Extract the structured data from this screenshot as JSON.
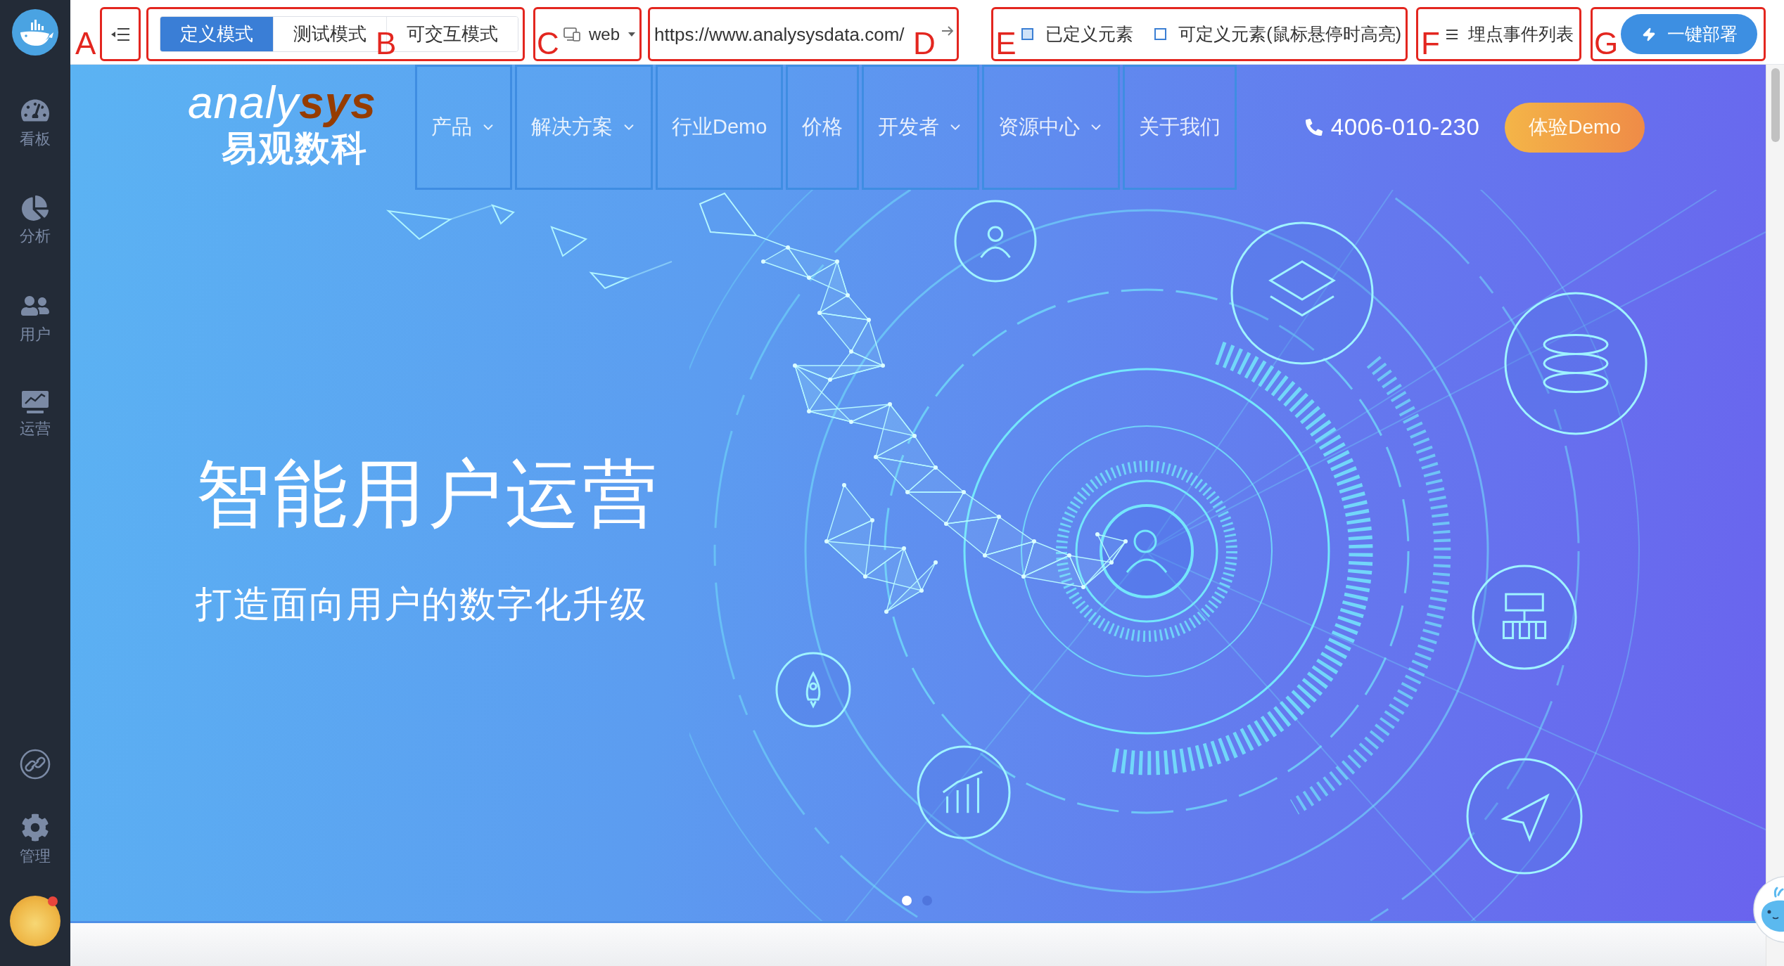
{
  "sidebar": {
    "items": [
      {
        "label": "看板",
        "kind": "gauge",
        "selected": false
      },
      {
        "label": "分析",
        "kind": "pie",
        "selected": false
      },
      {
        "label": "用户",
        "kind": "users",
        "selected": false
      },
      {
        "label": "运营",
        "kind": "monitor",
        "selected": false
      }
    ],
    "bottom_items": [
      {
        "kind": "link",
        "selected": false
      },
      {
        "label": "管理",
        "kind": "gear",
        "selected": false
      }
    ],
    "avatar": {
      "unread": true
    }
  },
  "toolbar": {
    "menu_toggle": {
      "annotation": "A"
    },
    "modes": {
      "annotation": "B",
      "items": [
        {
          "label": "定义模式",
          "selected": true
        },
        {
          "label": "测试模式",
          "selected": false
        },
        {
          "label": "可交互模式",
          "selected": false
        }
      ]
    },
    "platform": {
      "annotation": "C",
      "value": "web"
    },
    "url": {
      "annotation": "D",
      "value": "https://www.analysysdata.com/"
    },
    "legend": {
      "annotation": "E",
      "items": [
        {
          "label": "已定义元素",
          "kind": "filled"
        },
        {
          "label": "可定义元素(鼠标悬停时高亮)",
          "kind": "outline"
        }
      ]
    },
    "event_list": {
      "annotation": "F",
      "label": "埋点事件列表"
    },
    "deploy": {
      "annotation": "G",
      "label": "一键部署"
    }
  },
  "website": {
    "logo": {
      "wordmark": "analy",
      "wordmark_accent": "sys",
      "name": "易观数科"
    },
    "nav": [
      {
        "label": "产品",
        "dropdown": true,
        "outlined": true
      },
      {
        "label": "解决方案",
        "dropdown": true,
        "outlined": true
      },
      {
        "label": "行业Demo",
        "dropdown": false,
        "outlined": true
      },
      {
        "label": "价格",
        "dropdown": false,
        "outlined": true
      },
      {
        "label": "开发者",
        "dropdown": true,
        "outlined": true
      },
      {
        "label": "资源中心",
        "dropdown": true,
        "outlined": true
      },
      {
        "label": "关于我们",
        "dropdown": false,
        "outlined": true
      }
    ],
    "phone": "4006-010-230",
    "cta": "体验Demo",
    "hero": {
      "title": "智能用户运营",
      "subtitle": "打造面向用户的数字化升级",
      "slides": [
        {
          "selected": true
        },
        {
          "selected": false
        }
      ]
    }
  }
}
